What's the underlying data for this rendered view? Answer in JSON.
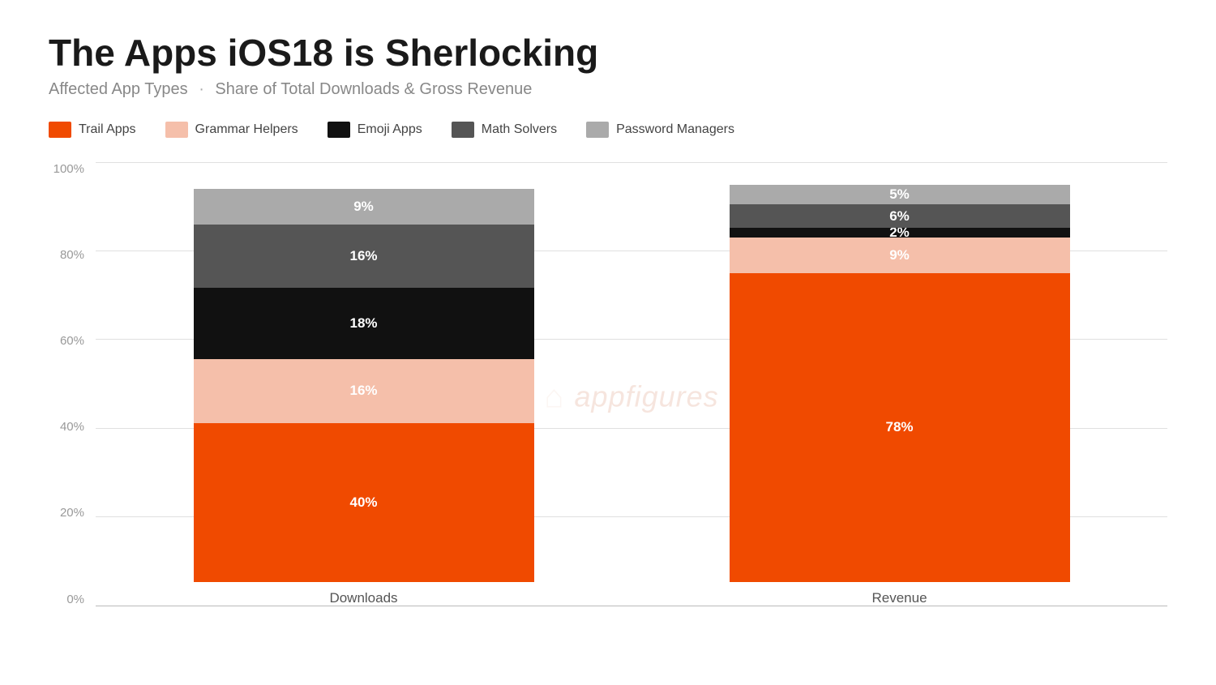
{
  "page": {
    "title": "The Apps iOS18 is Sherlocking",
    "subtitle_part1": "Affected App Types",
    "subtitle_separator": "·",
    "subtitle_part2": "Share of Total Downloads & Gross Revenue",
    "watermark_text": "appfigures"
  },
  "legend": {
    "items": [
      {
        "id": "trail_apps",
        "label": "Trail Apps",
        "color": "#f04a00"
      },
      {
        "id": "grammar_helpers",
        "label": "Grammar Helpers",
        "color": "#f5bfaa"
      },
      {
        "id": "emoji_apps",
        "label": "Emoji Apps",
        "color": "#111111"
      },
      {
        "id": "math_solvers",
        "label": "Math Solvers",
        "color": "#555555"
      },
      {
        "id": "password_managers",
        "label": "Password Managers",
        "color": "#aaaaaa"
      }
    ]
  },
  "y_axis": {
    "labels": [
      "0%",
      "20%",
      "40%",
      "60%",
      "80%",
      "100%"
    ]
  },
  "bars": [
    {
      "id": "downloads",
      "label": "Downloads",
      "segments": [
        {
          "id": "trail_apps",
          "pct": 40,
          "color": "#f04a00",
          "label": "40%",
          "text_color": "white"
        },
        {
          "id": "grammar_helpers",
          "pct": 16,
          "color": "#f5bfaa",
          "label": "16%",
          "text_color": "white"
        },
        {
          "id": "emoji_apps",
          "pct": 18,
          "color": "#111111",
          "label": "18%",
          "text_color": "white"
        },
        {
          "id": "math_solvers",
          "pct": 16,
          "color": "#555555",
          "label": "16%",
          "text_color": "white"
        },
        {
          "id": "password_managers",
          "pct": 9,
          "color": "#aaaaaa",
          "label": "9%",
          "text_color": "white"
        }
      ]
    },
    {
      "id": "revenue",
      "label": "Revenue",
      "segments": [
        {
          "id": "trail_apps",
          "pct": 78,
          "color": "#f04a00",
          "label": "78%",
          "text_color": "white"
        },
        {
          "id": "grammar_helpers",
          "pct": 9,
          "color": "#f5bfaa",
          "label": "9%",
          "text_color": "white"
        },
        {
          "id": "emoji_apps",
          "pct": 2,
          "color": "#111111",
          "label": "2%",
          "text_color": "white"
        },
        {
          "id": "math_solvers",
          "pct": 6,
          "color": "#555555",
          "label": "6%",
          "text_color": "white"
        },
        {
          "id": "password_managers",
          "pct": 5,
          "color": "#aaaaaa",
          "label": "5%",
          "text_color": "white"
        }
      ]
    }
  ]
}
